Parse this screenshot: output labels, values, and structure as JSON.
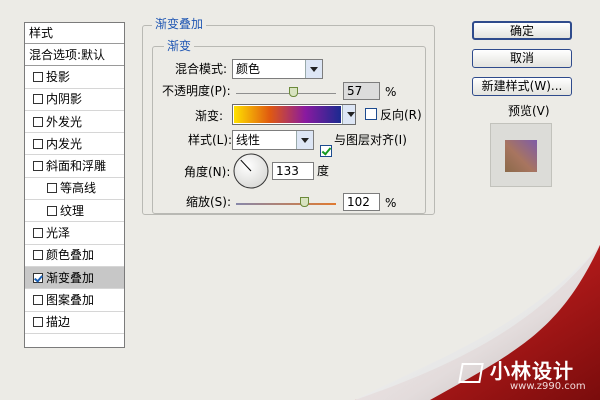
{
  "sidebar": {
    "header": "样式",
    "items": [
      {
        "label": "混合选项:默认",
        "checkbox": false
      },
      {
        "label": "投影",
        "checkbox": true,
        "checked": false
      },
      {
        "label": "内阴影",
        "checkbox": true,
        "checked": false
      },
      {
        "label": "外发光",
        "checkbox": true,
        "checked": false
      },
      {
        "label": "内发光",
        "checkbox": true,
        "checked": false
      },
      {
        "label": "斜面和浮雕",
        "checkbox": true,
        "checked": false
      },
      {
        "label": "等高线",
        "checkbox": true,
        "checked": false,
        "indent": true
      },
      {
        "label": "纹理",
        "checkbox": true,
        "checked": false,
        "indent": true
      },
      {
        "label": "光泽",
        "checkbox": true,
        "checked": false
      },
      {
        "label": "颜色叠加",
        "checkbox": true,
        "checked": false
      },
      {
        "label": "渐变叠加",
        "checkbox": true,
        "checked": true,
        "selected": true
      },
      {
        "label": "图案叠加",
        "checkbox": true,
        "checked": false
      },
      {
        "label": "描边",
        "checkbox": true,
        "checked": false
      }
    ]
  },
  "panel": {
    "outer_title": "渐变叠加",
    "inner_title": "渐变",
    "blend_mode": {
      "label": "混合模式:",
      "value": "颜色"
    },
    "opacity": {
      "label": "不透明度(P):",
      "value": "57",
      "unit": "%",
      "level": 0.57
    },
    "gradient": {
      "label": "渐变:",
      "colors": [
        "#ffe100",
        "#e05a10",
        "#8a1aa0",
        "#1a2a90"
      ]
    },
    "reverse": {
      "label": "反向(R)",
      "checked": false
    },
    "style": {
      "label": "样式(L):",
      "value": "线性"
    },
    "align": {
      "label": "与图层对齐(I)",
      "checked": true
    },
    "angle": {
      "label": "角度(N):",
      "value": "133",
      "unit": "度"
    },
    "scale": {
      "label": "缩放(S):",
      "value": "102",
      "unit": "%",
      "level": 0.68
    }
  },
  "buttons": {
    "ok": "确定",
    "cancel": "取消",
    "new_style": "新建样式(W)..."
  },
  "preview": {
    "label": "预览(V)",
    "checked": true
  },
  "watermark": {
    "brand": "小林设计",
    "url": "www.z990.com"
  },
  "colors": {
    "accent": "#2057b3",
    "page_curl": "#9c1414"
  }
}
